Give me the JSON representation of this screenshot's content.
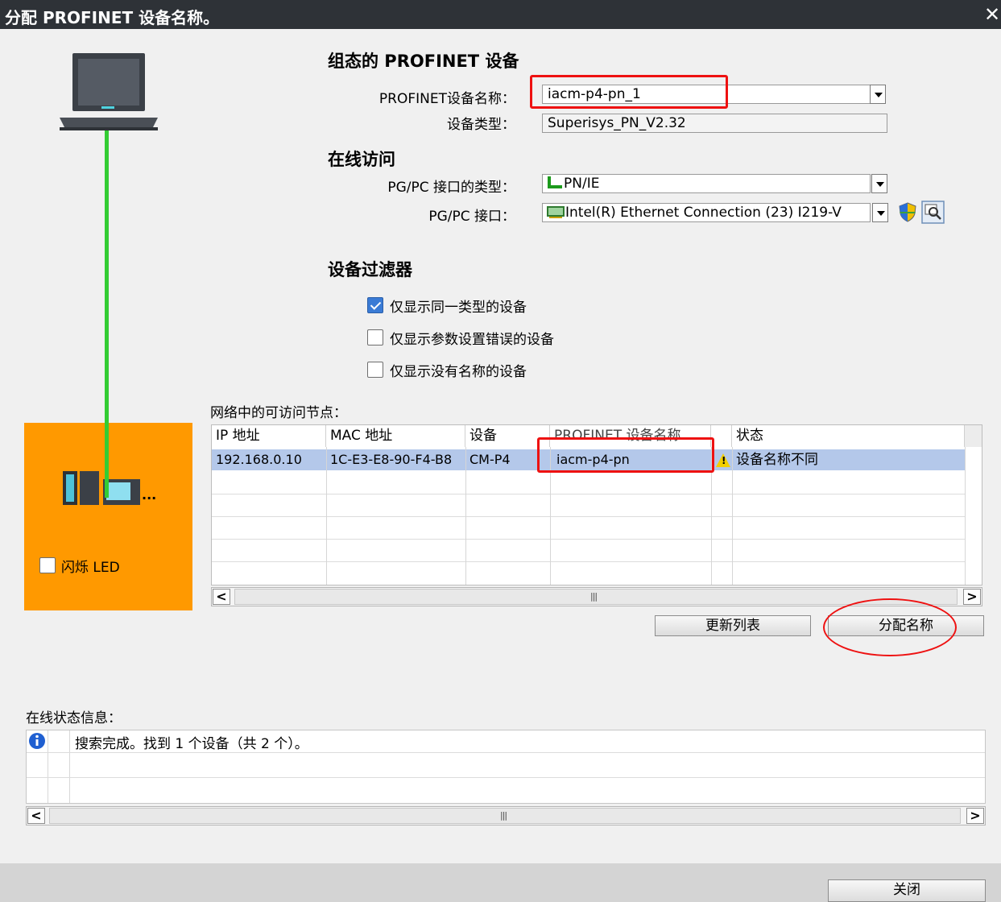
{
  "window": {
    "title": "分配 PROFINET 设备名称。",
    "close_glyph": "✕"
  },
  "configured_device": {
    "heading": "组态的 PROFINET 设备",
    "name_label": "PROFINET设备名称：",
    "name_value": "iacm-p4-pn_1",
    "type_label": "设备类型：",
    "type_value": "Superisys_PN_V2.32"
  },
  "online_access": {
    "heading": "在线访问",
    "interface_type_label": "PG/PC 接口的类型：",
    "interface_type_value": "PN/IE",
    "interface_label": "PG/PC 接口：",
    "interface_value": "Intel(R) Ethernet Connection (23) I219-V"
  },
  "device_filter": {
    "heading": "设备过滤器",
    "options": [
      {
        "label": "仅显示同一类型的设备",
        "checked": true
      },
      {
        "label": "仅显示参数设置错误的设备",
        "checked": false
      },
      {
        "label": "仅显示没有名称的设备",
        "checked": false
      }
    ]
  },
  "nodes": {
    "label": "网络中的可访问节点：",
    "columns": [
      "IP 地址",
      "MAC 地址",
      "设备",
      "PROFINET 设备名称",
      "",
      "状态"
    ],
    "rows": [
      {
        "ip": "192.168.0.10",
        "mac": "1C-E3-E8-90-F4-B8",
        "device": "CM-P4",
        "name": "iacm-p4-pn",
        "status": "设备名称不同"
      }
    ]
  },
  "left_panel": {
    "flash_led_label": "闪烁 LED",
    "flash_led_checked": false,
    "device_ellipsis": "..."
  },
  "buttons": {
    "update_list": "更新列表",
    "assign_name": "分配名称",
    "close": "关闭"
  },
  "online_status": {
    "label": "在线状态信息：",
    "messages": [
      {
        "icon": "info-icon",
        "text": "搜索完成。找到 1 个设备（共 2 个）。"
      }
    ]
  },
  "scroll": {
    "grip": "|||"
  },
  "colors": {
    "orange_panel": "#ff9900",
    "selected_row": "#b4c8ea",
    "highlight_red": "#ee1111",
    "link_line": "#33cc33"
  }
}
